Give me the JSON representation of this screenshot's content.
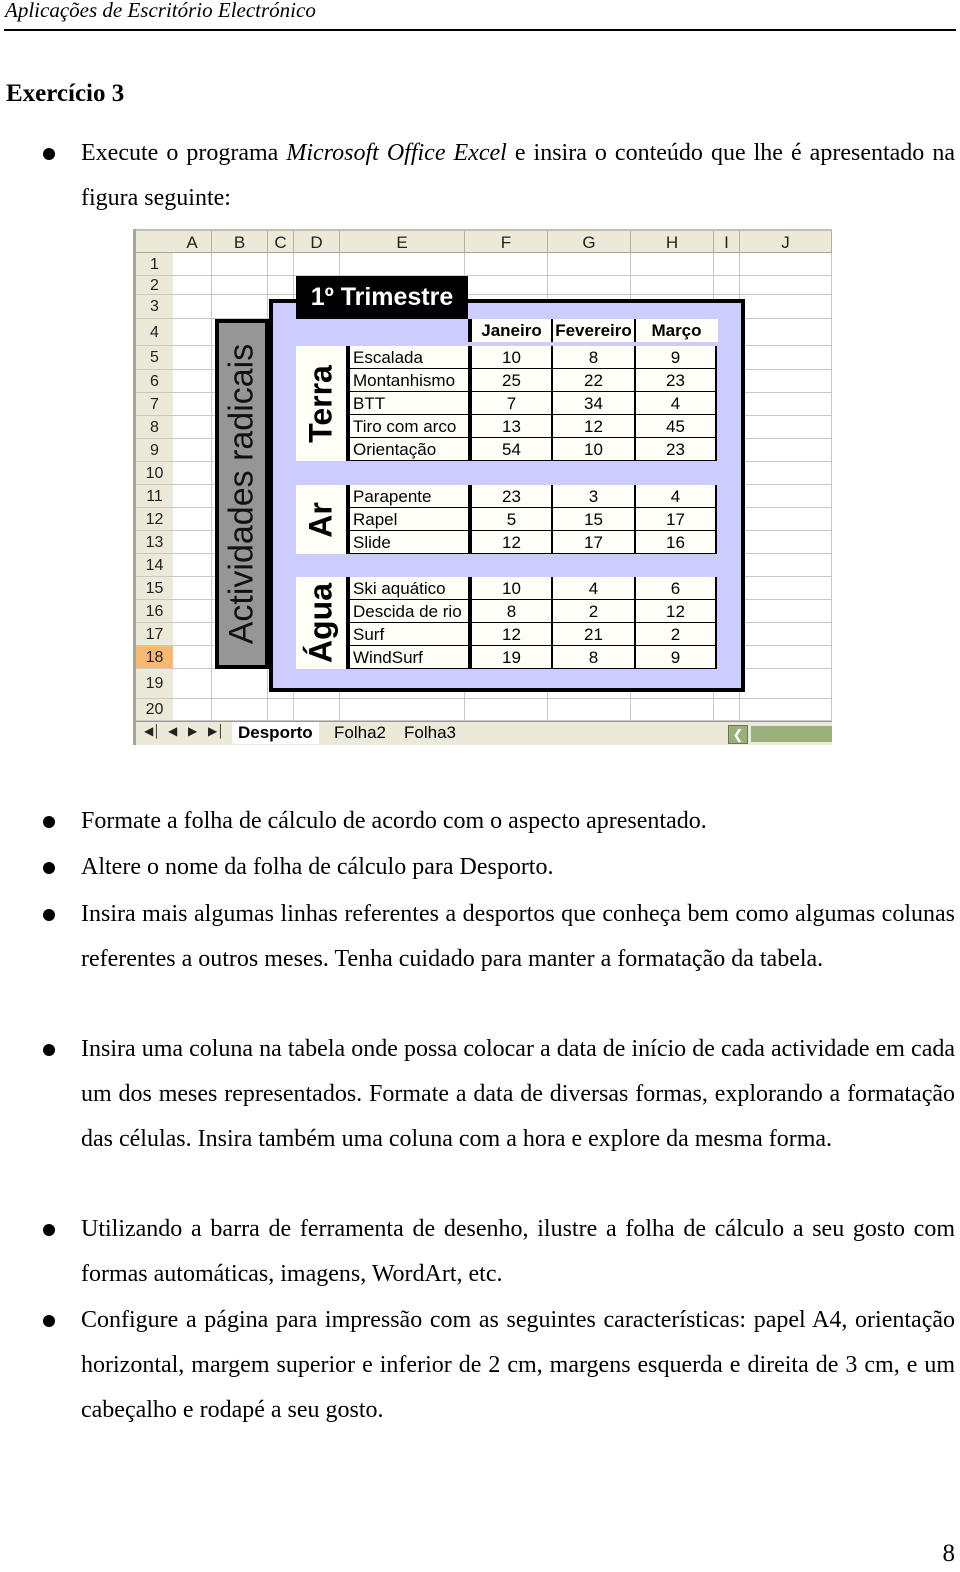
{
  "running_header": "Aplicações de Escritório Electrónico",
  "exercise_title": "Exercício 3",
  "intro": {
    "before": "Execute o programa ",
    "italic": "Microsoft Office Excel",
    "after": " e insira o conteúdo que lhe é apresentado na figura seguinte:"
  },
  "spreadsheet": {
    "columns": [
      "A",
      "B",
      "C",
      "D",
      "E",
      "F",
      "G",
      "H",
      "I",
      "J"
    ],
    "rows": [
      "1",
      "2",
      "3",
      "4",
      "5",
      "6",
      "7",
      "8",
      "9",
      "10",
      "11",
      "12",
      "13",
      "14",
      "15",
      "16",
      "17",
      "18",
      "19",
      "20"
    ],
    "selected_row": "18",
    "outer_label": "Actividades radicais",
    "title": "1º Trimestre",
    "months": [
      "Janeiro",
      "Fevereiro",
      "Março"
    ],
    "groups": [
      {
        "label": "Terra",
        "items": [
          {
            "name": "Escalada",
            "values": [
              "10",
              "8",
              "9"
            ]
          },
          {
            "name": "Montanhismo",
            "values": [
              "25",
              "22",
              "23"
            ]
          },
          {
            "name": "BTT",
            "values": [
              "7",
              "34",
              "4"
            ]
          },
          {
            "name": "Tiro com arco",
            "values": [
              "13",
              "12",
              "45"
            ]
          },
          {
            "name": "Orientação",
            "values": [
              "54",
              "10",
              "23"
            ]
          }
        ]
      },
      {
        "label": "Ar",
        "items": [
          {
            "name": "Parapente",
            "values": [
              "23",
              "3",
              "4"
            ]
          },
          {
            "name": "Rapel",
            "values": [
              "5",
              "15",
              "17"
            ]
          },
          {
            "name": "Slide",
            "values": [
              "12",
              "17",
              "16"
            ]
          }
        ]
      },
      {
        "label": "Água",
        "items": [
          {
            "name": "Ski aquático",
            "values": [
              "10",
              "4",
              "6"
            ]
          },
          {
            "name": "Descida de rio",
            "values": [
              "8",
              "2",
              "12"
            ]
          },
          {
            "name": "Surf",
            "values": [
              "12",
              "21",
              "2"
            ]
          },
          {
            "name": "WindSurf",
            "values": [
              "19",
              "8",
              "9"
            ]
          }
        ]
      }
    ],
    "sheet_tabs": [
      "Desporto",
      "Folha2",
      "Folha3"
    ],
    "active_tab": "Desporto",
    "nav_icons": [
      "first-sheet-icon",
      "prev-sheet-icon",
      "next-sheet-icon",
      "last-sheet-icon"
    ],
    "colors": {
      "table_bg": "#ccccff",
      "outer_label_bg": "#969696",
      "title_bg": "#000000",
      "selected_row_header": "#f8b870"
    }
  },
  "bullets": [
    "Formate a folha de cálculo de acordo com o aspecto apresentado.",
    "Altere o nome da folha de cálculo para Desporto.",
    "Insira mais algumas linhas referentes a desportos que conheça bem como algumas colunas referentes a outros meses. Tenha cuidado para manter a formatação da tabela.",
    "Insira uma coluna na tabela onde possa colocar a data de início de cada actividade em cada um dos meses representados. Formate a data de diversas formas, explorando a formatação das células. Insira também uma coluna com a hora e explore da mesma forma.",
    "Utilizando a barra de ferramenta de desenho, ilustre a folha de cálculo a seu gosto com formas automáticas, imagens, WordArt, etc.",
    "Configure a página para impressão com as seguintes características: papel A4, orientação horizontal, margem superior e inferior de 2 cm, margens esquerda e direita de 3 cm, e um cabeçalho e rodapé a seu gosto."
  ],
  "page_number": "8"
}
